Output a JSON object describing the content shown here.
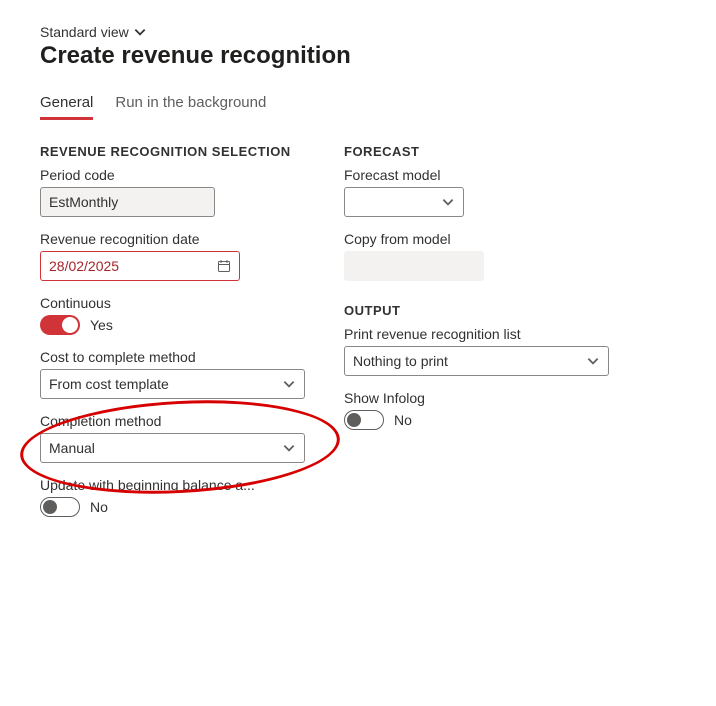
{
  "view_switch": {
    "label": "Standard view"
  },
  "page_title": "Create revenue recognition",
  "tabs": {
    "general": "General",
    "background": "Run in the background"
  },
  "left": {
    "section": "REVENUE RECOGNITION SELECTION",
    "period_code": {
      "label": "Period code",
      "value": "EstMonthly"
    },
    "rev_date": {
      "label": "Revenue recognition date",
      "value": "28/02/2025"
    },
    "continuous": {
      "label": "Continuous",
      "state": "Yes"
    },
    "cost_method": {
      "label": "Cost to complete method",
      "value": "From cost template"
    },
    "completion_method": {
      "label": "Completion method",
      "value": "Manual"
    },
    "update_begin": {
      "label": "Update with beginning balance a...",
      "state": "No"
    }
  },
  "right": {
    "forecast_section": "FORECAST",
    "forecast_model": {
      "label": "Forecast model",
      "value": ""
    },
    "copy_from": {
      "label": "Copy from model"
    },
    "output_section": "OUTPUT",
    "print_list": {
      "label": "Print revenue recognition list",
      "value": "Nothing to print"
    },
    "show_infolog": {
      "label": "Show Infolog",
      "state": "No"
    }
  }
}
